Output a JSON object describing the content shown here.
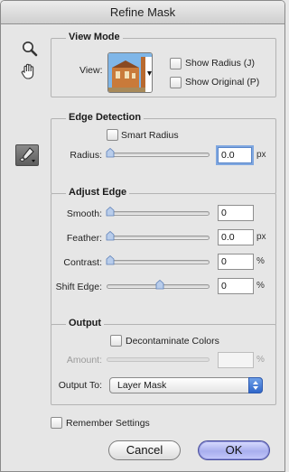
{
  "window": {
    "title": "Refine Mask"
  },
  "tools": {
    "zoom_icon": "zoom-magnifier-icon",
    "hand_icon": "hand-icon",
    "brush_icon": "refine-radius-brush-icon"
  },
  "view_mode": {
    "legend": "View Mode",
    "view_label": "View:",
    "show_radius_label": "Show Radius (J)",
    "show_original_label": "Show Original (P)"
  },
  "edge_detection": {
    "legend": "Edge Detection",
    "smart_radius_label": "Smart Radius",
    "radius_label": "Radius:",
    "radius_value": "0.0",
    "radius_unit": "px",
    "radius_slider_value": 0
  },
  "adjust_edge": {
    "legend": "Adjust Edge",
    "smooth_label": "Smooth:",
    "smooth_value": "0",
    "feather_label": "Feather:",
    "feather_value": "0.0",
    "feather_unit": "px",
    "contrast_label": "Contrast:",
    "contrast_value": "0",
    "contrast_unit": "%",
    "shift_label": "Shift Edge:",
    "shift_value": "0",
    "shift_unit": "%"
  },
  "output": {
    "legend": "Output",
    "decontaminate_label": "Decontaminate Colors",
    "amount_label": "Amount:",
    "amount_value": "",
    "amount_unit": "%",
    "output_to_label": "Output To:",
    "output_to_value": "Layer Mask"
  },
  "remember_label": "Remember Settings",
  "buttons": {
    "cancel": "Cancel",
    "ok": "OK"
  },
  "colors": {
    "accent_blue": "#3a72d0",
    "ok_button": "#b3b8f2"
  }
}
